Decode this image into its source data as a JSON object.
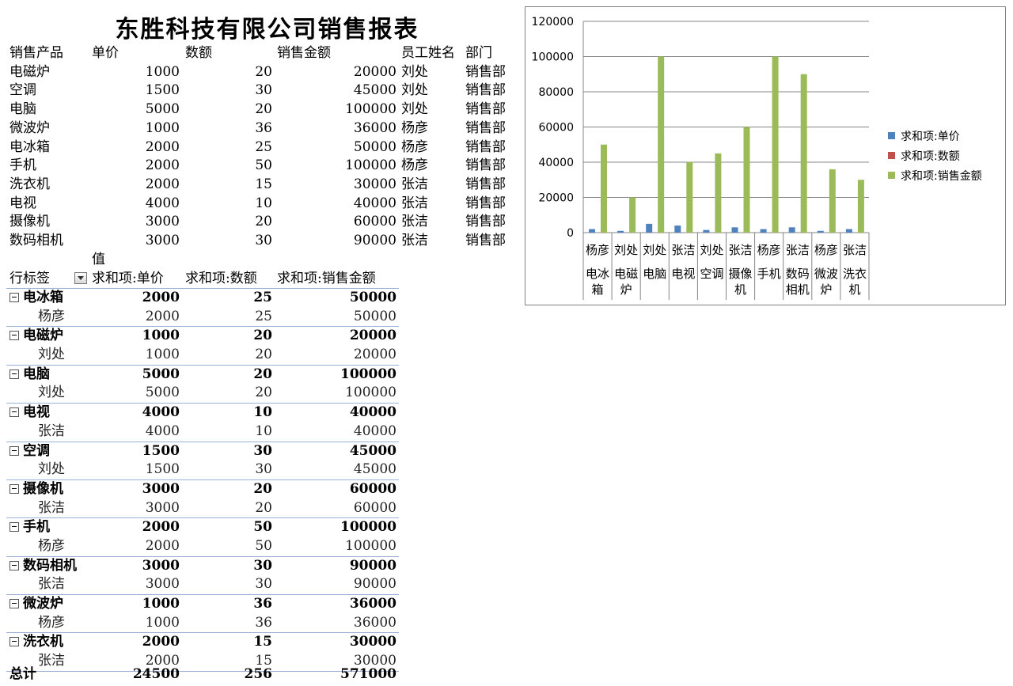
{
  "title": "东胜科技有限公司销售报表",
  "source_table": {
    "headers": [
      "销售产品",
      "单价",
      "数额",
      "销售金额",
      "员工姓名",
      "部门"
    ],
    "rows": [
      [
        "电磁炉",
        "1000",
        "20",
        "20000",
        "刘处",
        "销售部"
      ],
      [
        "空调",
        "1500",
        "30",
        "45000",
        "刘处",
        "销售部"
      ],
      [
        "电脑",
        "5000",
        "20",
        "100000",
        "刘处",
        "销售部"
      ],
      [
        "微波炉",
        "1000",
        "36",
        "36000",
        "杨彦",
        "销售部"
      ],
      [
        "电冰箱",
        "2000",
        "25",
        "50000",
        "杨彦",
        "销售部"
      ],
      [
        "手机",
        "2000",
        "50",
        "100000",
        "杨彦",
        "销售部"
      ],
      [
        "洗衣机",
        "2000",
        "15",
        "30000",
        "张洁",
        "销售部"
      ],
      [
        "电视",
        "4000",
        "10",
        "40000",
        "张洁",
        "销售部"
      ],
      [
        "摄像机",
        "3000",
        "20",
        "60000",
        "张洁",
        "销售部"
      ],
      [
        "数码相机",
        "3000",
        "30",
        "90000",
        "张洁",
        "销售部"
      ]
    ]
  },
  "pivot": {
    "values_label": "值",
    "headers": [
      "行标签",
      "求和项:单价",
      "求和项:数额",
      "求和项:销售金额"
    ],
    "groups": [
      {
        "label": "电冰箱",
        "price": "2000",
        "qty": "25",
        "amount": "50000",
        "child": {
          "label": "杨彦",
          "price": "2000",
          "qty": "25",
          "amount": "50000"
        }
      },
      {
        "label": "电磁炉",
        "price": "1000",
        "qty": "20",
        "amount": "20000",
        "child": {
          "label": "刘处",
          "price": "1000",
          "qty": "20",
          "amount": "20000"
        }
      },
      {
        "label": "电脑",
        "price": "5000",
        "qty": "20",
        "amount": "100000",
        "child": {
          "label": "刘处",
          "price": "5000",
          "qty": "20",
          "amount": "100000"
        }
      },
      {
        "label": "电视",
        "price": "4000",
        "qty": "10",
        "amount": "40000",
        "child": {
          "label": "张洁",
          "price": "4000",
          "qty": "10",
          "amount": "40000"
        }
      },
      {
        "label": "空调",
        "price": "1500",
        "qty": "30",
        "amount": "45000",
        "child": {
          "label": "刘处",
          "price": "1500",
          "qty": "30",
          "amount": "45000"
        }
      },
      {
        "label": "摄像机",
        "price": "3000",
        "qty": "20",
        "amount": "60000",
        "child": {
          "label": "张洁",
          "price": "3000",
          "qty": "20",
          "amount": "60000"
        }
      },
      {
        "label": "手机",
        "price": "2000",
        "qty": "50",
        "amount": "100000",
        "child": {
          "label": "杨彦",
          "price": "2000",
          "qty": "50",
          "amount": "100000"
        }
      },
      {
        "label": "数码相机",
        "price": "3000",
        "qty": "30",
        "amount": "90000",
        "child": {
          "label": "张洁",
          "price": "3000",
          "qty": "30",
          "amount": "90000"
        }
      },
      {
        "label": "微波炉",
        "price": "1000",
        "qty": "36",
        "amount": "36000",
        "child": {
          "label": "杨彦",
          "price": "1000",
          "qty": "36",
          "amount": "36000"
        }
      },
      {
        "label": "洗衣机",
        "price": "2000",
        "qty": "15",
        "amount": "30000",
        "child": {
          "label": "张洁",
          "price": "2000",
          "qty": "15",
          "amount": "30000"
        }
      }
    ],
    "total": {
      "label": "总计",
      "price": "24500",
      "qty": "256",
      "amount": "571000"
    }
  },
  "chart_data": {
    "type": "bar",
    "categories": [
      {
        "employee": "杨彦",
        "product": "电冰箱"
      },
      {
        "employee": "刘处",
        "product": "电磁炉"
      },
      {
        "employee": "刘处",
        "product": "电脑"
      },
      {
        "employee": "张洁",
        "product": "电视"
      },
      {
        "employee": "刘处",
        "product": "空调"
      },
      {
        "employee": "张洁",
        "product": "摄像机"
      },
      {
        "employee": "杨彦",
        "product": "手机"
      },
      {
        "employee": "张洁",
        "product": "数码相机"
      },
      {
        "employee": "杨彦",
        "product": "微波炉"
      },
      {
        "employee": "张洁",
        "product": "洗衣机"
      }
    ],
    "series": [
      {
        "name": "求和项:单价",
        "color": "#4f81bd",
        "values": [
          2000,
          1000,
          5000,
          4000,
          1500,
          3000,
          2000,
          3000,
          1000,
          2000
        ]
      },
      {
        "name": "求和项:数额",
        "color": "#c0504d",
        "values": [
          25,
          20,
          20,
          10,
          30,
          20,
          50,
          30,
          36,
          15
        ]
      },
      {
        "name": "求和项:销售金额",
        "color": "#9bbb59",
        "values": [
          50000,
          20000,
          100000,
          40000,
          45000,
          60000,
          100000,
          90000,
          36000,
          30000
        ]
      }
    ],
    "ylim": [
      0,
      120000
    ],
    "yticks": [
      "0",
      "20000",
      "40000",
      "60000",
      "80000",
      "100000",
      "120000"
    ],
    "grid": true,
    "legend": "right"
  }
}
